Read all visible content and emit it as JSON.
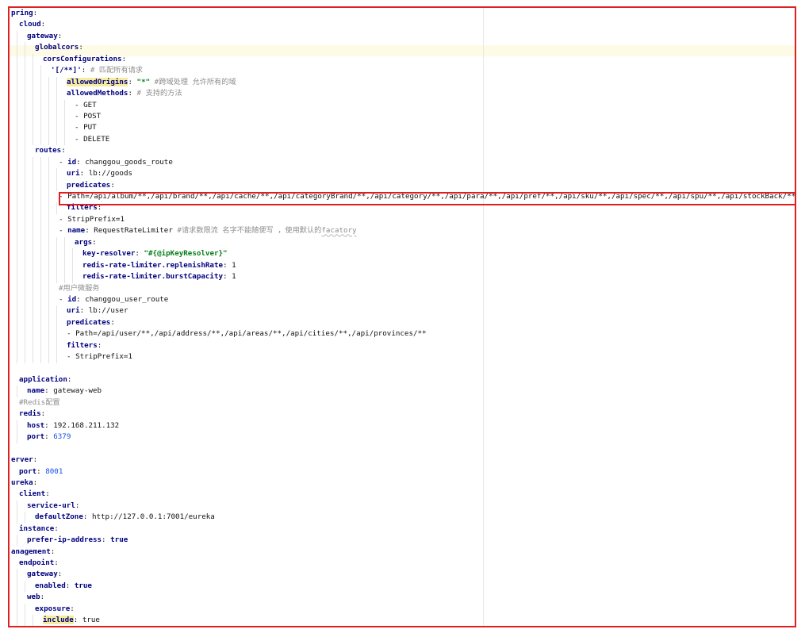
{
  "lines": [
    {
      "i": 0,
      "key": "pring",
      "sep": ":"
    },
    {
      "i": 1,
      "key": "cloud",
      "sep": ":"
    },
    {
      "i": 2,
      "key": "gateway",
      "sep": ":"
    },
    {
      "i": 3,
      "key": "globalcors",
      "sep": ":"
    },
    {
      "i": 4,
      "key": "corsConfigurations",
      "sep": ":"
    },
    {
      "i": 5,
      "key": "'[/**]'",
      "sep": ": ",
      "comment": "# 匹配所有请求"
    },
    {
      "i": 7,
      "key": "allowedOrigins",
      "key_hl": true,
      "sep": ": ",
      "str": "\"*\"",
      "comment": " #跨域处理 允许所有的域"
    },
    {
      "i": 7,
      "key": "allowedMethods",
      "sep": ": ",
      "comment": "# 支持的方法"
    },
    {
      "i": 8,
      "plain": "- GET"
    },
    {
      "i": 8,
      "plain": "- POST"
    },
    {
      "i": 8,
      "plain": "- PUT"
    },
    {
      "i": 8,
      "plain": "- DELETE"
    },
    {
      "i": 3,
      "key": "routes",
      "sep": ":"
    },
    {
      "i": 6,
      "dash": true,
      "key": "id",
      "sep": ": ",
      "val": "changgou_goods_route"
    },
    {
      "i": 7,
      "key": "uri",
      "sep": ": ",
      "val": "lb://goods"
    },
    {
      "i": 7,
      "key": "predicates",
      "sep": ":"
    },
    {
      "i": 6,
      "plain": "- Path=/api/album/**,/api/brand/**,/api/cache/**,/api/categoryBrand/**,/api/category/**,/api/para/**,/api/pref/**,/api/sku/**,/api/spec/**,/api/spu/**,/api/stockBack/**,/api/template/**"
    },
    {
      "i": 7,
      "key": "filters",
      "sep": ":"
    },
    {
      "i": 6,
      "plain": "- StripPrefix=1"
    },
    {
      "i": 6,
      "dash": true,
      "key": "name",
      "sep": ": ",
      "val": "RequestRateLimiter ",
      "comment": "#请求数限流 名字不能随便写 ，使用默认的",
      "squiggle": "facatory"
    },
    {
      "i": 8,
      "key": "args",
      "sep": ":"
    },
    {
      "i": 9,
      "key": "key-resolver",
      "sep": ": ",
      "str": "\"#{@ipKeyResolver}\""
    },
    {
      "i": 9,
      "key": "redis-rate-limiter.replenishRate",
      "sep": ": ",
      "val": "1"
    },
    {
      "i": 9,
      "key": "redis-rate-limiter.burstCapacity",
      "sep": ": ",
      "val": "1"
    },
    {
      "i": 6,
      "comment": "#用户微服务"
    },
    {
      "i": 6,
      "dash": true,
      "key": "id",
      "sep": ": ",
      "val": "changgou_user_route"
    },
    {
      "i": 7,
      "key": "uri",
      "sep": ": ",
      "val": "lb://user"
    },
    {
      "i": 7,
      "key": "predicates",
      "sep": ":"
    },
    {
      "i": 7,
      "plain": "- Path=/api/user/**,/api/address/**,/api/areas/**,/api/cities/**,/api/provinces/**"
    },
    {
      "i": 7,
      "key": "filters",
      "sep": ":"
    },
    {
      "i": 7,
      "plain": "- StripPrefix=1"
    },
    {
      "i": 0,
      "blank": true
    },
    {
      "i": 1,
      "key": "application",
      "sep": ":"
    },
    {
      "i": 2,
      "key": "name",
      "sep": ": ",
      "val": "gateway-web"
    },
    {
      "i": 1,
      "comment": "#Redis配置"
    },
    {
      "i": 1,
      "key": "redis",
      "sep": ":"
    },
    {
      "i": 2,
      "key": "host",
      "sep": ": ",
      "val": "192.168.211.132"
    },
    {
      "i": 2,
      "key": "port",
      "sep": ": ",
      "num": "6379"
    },
    {
      "i": 0,
      "blank": true
    },
    {
      "i": 0,
      "key": "erver",
      "sep": ":"
    },
    {
      "i": 1,
      "key": "port",
      "sep": ": ",
      "num": "8001"
    },
    {
      "i": 0,
      "key": "ureka",
      "sep": ":"
    },
    {
      "i": 1,
      "key": "client",
      "sep": ":"
    },
    {
      "i": 2,
      "key": "service-url",
      "sep": ":"
    },
    {
      "i": 3,
      "key": "defaultZone",
      "sep": ": ",
      "val": "http://127.0.0.1:7001/eureka"
    },
    {
      "i": 1,
      "key": "instance",
      "sep": ":"
    },
    {
      "i": 2,
      "key": "prefer-ip-address",
      "sep": ": ",
      "kw": "true"
    },
    {
      "i": 0,
      "key": "anagement",
      "sep": ":"
    },
    {
      "i": 1,
      "key": "endpoint",
      "sep": ":"
    },
    {
      "i": 2,
      "key": "gateway",
      "sep": ":"
    },
    {
      "i": 3,
      "key": "enabled",
      "sep": ": ",
      "kw": "true"
    },
    {
      "i": 2,
      "key": "web",
      "sep": ":"
    },
    {
      "i": 3,
      "key": "exposure",
      "sep": ":"
    },
    {
      "i": 4,
      "key": "include",
      "key_hl": true,
      "sep": ": ",
      "val": "true"
    }
  ],
  "colors": {
    "frame": "#e02020",
    "key": "#000080",
    "string": "#067d17",
    "number": "#1750eb",
    "comment": "#8c8c8c",
    "key_highlight": "#f6ec9e"
  }
}
